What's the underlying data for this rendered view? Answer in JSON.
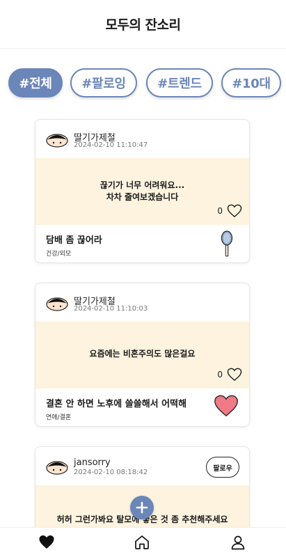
{
  "app": {
    "title": "모두의 잔소리"
  },
  "tabs": [
    {
      "label": "#전체",
      "active": true
    },
    {
      "label": "#팔로잉",
      "active": false
    },
    {
      "label": "#트렌드",
      "active": false
    },
    {
      "label": "#10대",
      "active": false
    }
  ],
  "posts": [
    {
      "author": "딸기가제철",
      "date": "2024-02-10 11:10:47",
      "body": "끊기가 너무 어려워요...\n차차 줄여보겠습니다",
      "likes": "0",
      "title": "담배 좀 끊어라",
      "category": "건강/외모",
      "footer_icon": "hand-mirror-icon"
    },
    {
      "author": "딸기가제철",
      "date": "2024-02-10 11:10:03",
      "body": "요즘에는 비혼주의도 많은걸요",
      "likes": "0",
      "title": "결혼 안 하면 노후에 쓸쓸해서 어떡해",
      "category": "연애/결혼",
      "footer_icon": "heart-icon"
    },
    {
      "author": "jansorry",
      "date": "2024-02-10 08:18:42",
      "follow_label": "팔로우",
      "body": "허허 그런가봐요 탈모에 좋은 것 좀 추천해주세요"
    }
  ],
  "colors": {
    "accent": "#6b86b8",
    "card_body_bg": "#fdf3df",
    "heart_fill": "#f07a85"
  },
  "nav": {
    "items": [
      "heart-icon",
      "home-icon",
      "profile-icon"
    ]
  }
}
